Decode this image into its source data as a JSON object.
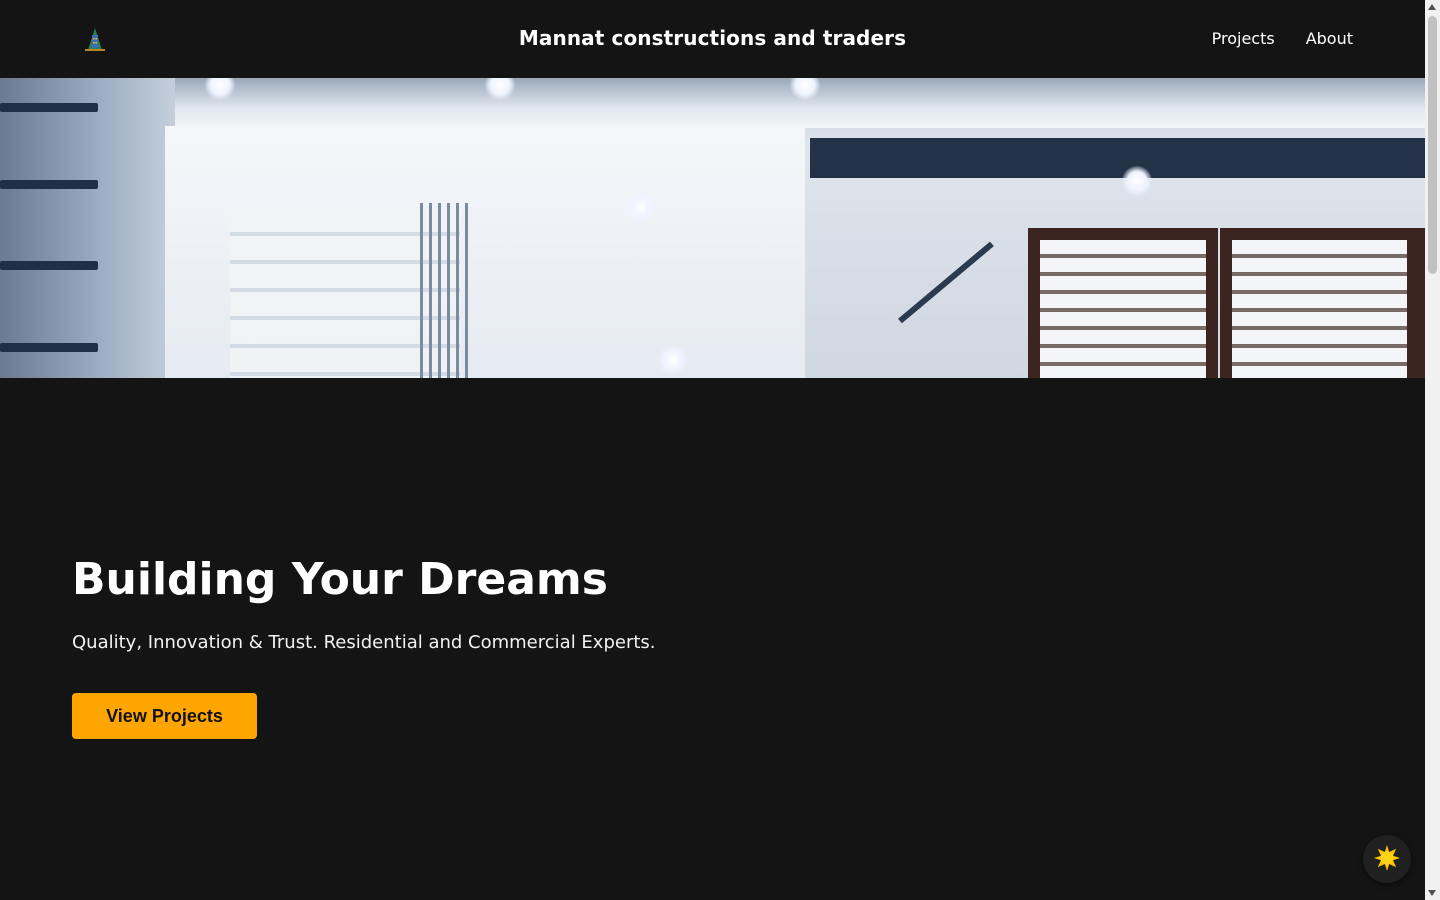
{
  "header": {
    "logo_icon": "building-logo-icon",
    "title": "Mannat constructions and traders",
    "nav": [
      {
        "label": "Projects"
      },
      {
        "label": "About"
      }
    ]
  },
  "hero": {
    "image": "interior-staircase-photo",
    "headline": "Building Your Dreams",
    "tagline": "Quality, Innovation & Trust. Residential and Commercial Experts.",
    "cta_label": "View Projects"
  },
  "theme_toggle": {
    "icon": "sun-icon"
  },
  "colors": {
    "background": "#141414",
    "accent": "#ffa500",
    "text": "#ffffff"
  }
}
